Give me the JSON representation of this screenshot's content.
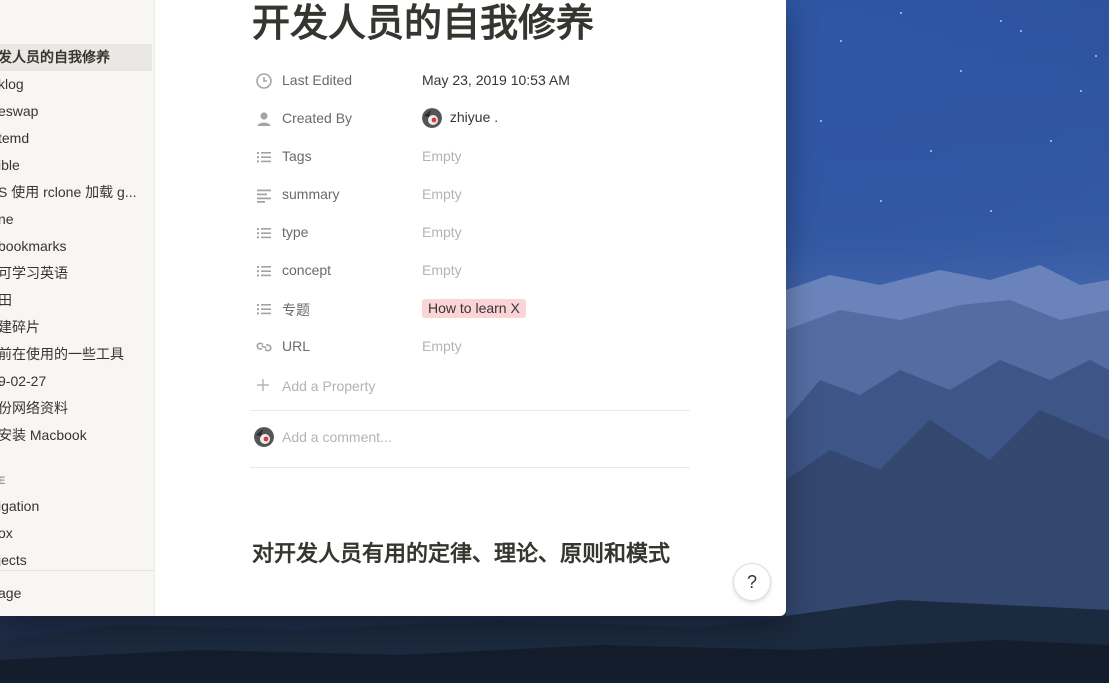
{
  "sidebar": {
    "items": [
      {
        "label": "发人员的自我修养",
        "active": true
      },
      {
        "label": "klog"
      },
      {
        "label": "eswap"
      },
      {
        "label": "temd"
      },
      {
        "label": "ible"
      },
      {
        "label": "S 使用 rclone 加载 g..."
      },
      {
        "label": "ne"
      },
      {
        "label": "bookmarks"
      },
      {
        "label": "可学习英语"
      },
      {
        "label": "田"
      },
      {
        "label": "建碎片"
      },
      {
        "label": "前在使用的一些工具"
      },
      {
        "label": "9-02-27"
      },
      {
        "label": "份网络资料"
      },
      {
        "label": "安装 Macbook"
      }
    ],
    "section_label": "E",
    "section_items": [
      {
        "label": "igation"
      },
      {
        "label": "ox"
      },
      {
        "label": "jects"
      }
    ],
    "bottom_item": "age"
  },
  "page": {
    "title": "开发人员的自我修养",
    "properties": [
      {
        "icon": "clock-icon",
        "name": "Last Edited",
        "value": "May 23, 2019 10:53 AM",
        "kind": "text"
      },
      {
        "icon": "person-icon",
        "name": "Created By",
        "value": "zhiyue .",
        "kind": "user"
      },
      {
        "icon": "list-icon",
        "name": "Tags",
        "value": "Empty",
        "kind": "empty"
      },
      {
        "icon": "text-lines-icon",
        "name": "summary",
        "value": "Empty",
        "kind": "empty"
      },
      {
        "icon": "list-icon",
        "name": "type",
        "value": "Empty",
        "kind": "empty"
      },
      {
        "icon": "list-icon",
        "name": "concept",
        "value": "Empty",
        "kind": "empty"
      },
      {
        "icon": "list-icon",
        "name": "专题",
        "value": "How to learn X",
        "kind": "tag"
      },
      {
        "icon": "link-icon",
        "name": "URL",
        "value": "Empty",
        "kind": "empty"
      }
    ],
    "add_property_label": "Add a Property",
    "comment_placeholder": "Add a comment...",
    "heading": "对开发人员有用的定律、理论、原则和模式",
    "help_label": "?"
  },
  "colors": {
    "tag_bg": "#fad4d7",
    "sidebar_bg": "#f7f6f3",
    "text": "#37352f",
    "muted": "#b4b3b0"
  }
}
